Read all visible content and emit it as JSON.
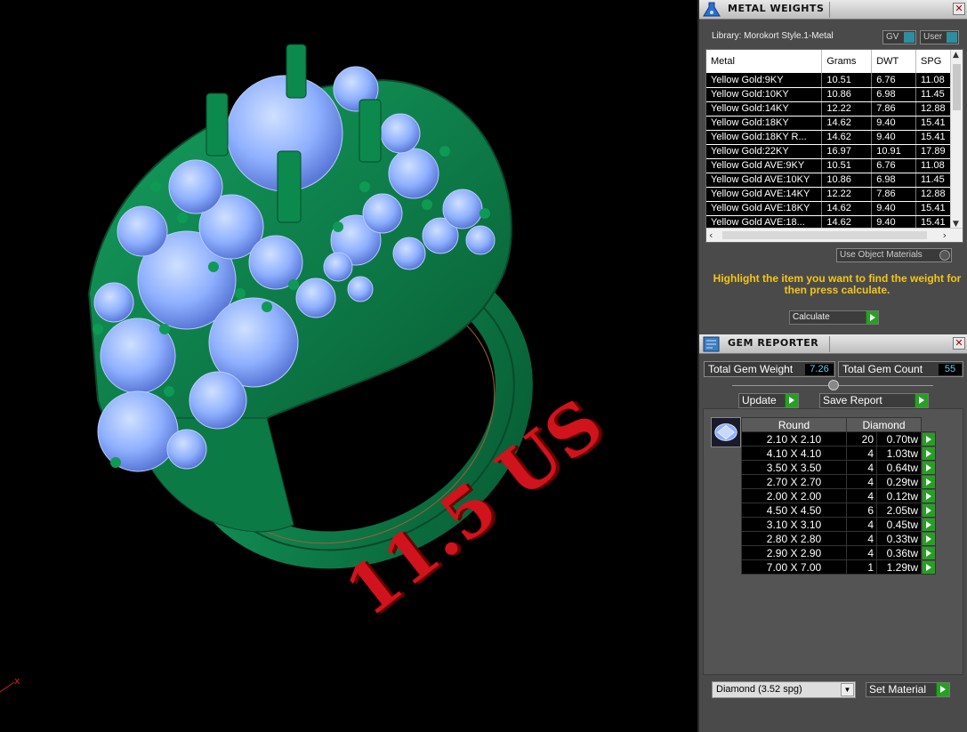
{
  "viewport": {
    "size_label": "11.5 US",
    "axis_label": "x",
    "colors": {
      "metal": "#0b7a45",
      "gem": "#8fb0ff",
      "label": "#d0131c"
    }
  },
  "metal_weights": {
    "title": "METAL WEIGHTS",
    "library": "Library: Morokort Style.1-Metal",
    "gv_toggle": "GV",
    "user_toggle": "User",
    "columns": [
      "Metal",
      "Grams",
      "DWT",
      "SPG"
    ],
    "rows": [
      [
        "Yellow Gold:9KY",
        "10.51",
        "6.76",
        "11.08"
      ],
      [
        "Yellow Gold:10KY",
        "10.86",
        "6.98",
        "11.45"
      ],
      [
        "Yellow Gold:14KY",
        "12.22",
        "7.86",
        "12.88"
      ],
      [
        "Yellow Gold:18KY",
        "14.62",
        "9.40",
        "15.41"
      ],
      [
        "Yellow Gold:18KY R...",
        "14.62",
        "9.40",
        "15.41"
      ],
      [
        "Yellow Gold:22KY",
        "16.97",
        "10.91",
        "17.89"
      ],
      [
        "Yellow Gold AVE:9KY",
        "10.51",
        "6.76",
        "11.08"
      ],
      [
        "Yellow Gold AVE:10KY",
        "10.86",
        "6.98",
        "11.45"
      ],
      [
        "Yellow Gold AVE:14KY",
        "12.22",
        "7.86",
        "12.88"
      ],
      [
        "Yellow Gold AVE:18KY",
        "14.62",
        "9.40",
        "15.41"
      ],
      [
        "Yellow Gold AVE:18...",
        "14.62",
        "9.40",
        "15.41"
      ]
    ],
    "use_object_materials": "Use Object Materials",
    "hint": "Highlight the item you want to find the weight for then press calculate.",
    "calculate": "Calculate"
  },
  "gem_reporter": {
    "title": "GEM REPORTER",
    "total_weight_label": "Total Gem Weight",
    "total_weight_value": "7.26",
    "total_count_label": "Total Gem Count",
    "total_count_value": "55",
    "update": "Update",
    "save_report": "Save Report",
    "columns": [
      "Round",
      "Diamond"
    ],
    "rows": [
      [
        "2.10 X 2.10",
        "20",
        "0.70tw"
      ],
      [
        "4.10 X 4.10",
        "4",
        "1.03tw"
      ],
      [
        "3.50 X 3.50",
        "4",
        "0.64tw"
      ],
      [
        "2.70 X 2.70",
        "4",
        "0.29tw"
      ],
      [
        "2.00 X 2.00",
        "4",
        "0.12tw"
      ],
      [
        "4.50 X 4.50",
        "6",
        "2.05tw"
      ],
      [
        "3.10 X 3.10",
        "4",
        "0.45tw"
      ],
      [
        "2.80 X 2.80",
        "4",
        "0.33tw"
      ],
      [
        "2.90 X 2.90",
        "4",
        "0.36tw"
      ],
      [
        "7.00 X 7.00",
        "1",
        "1.29tw"
      ]
    ],
    "material_select": "Diamond     (3.52 spg)",
    "set_material": "Set Material"
  }
}
